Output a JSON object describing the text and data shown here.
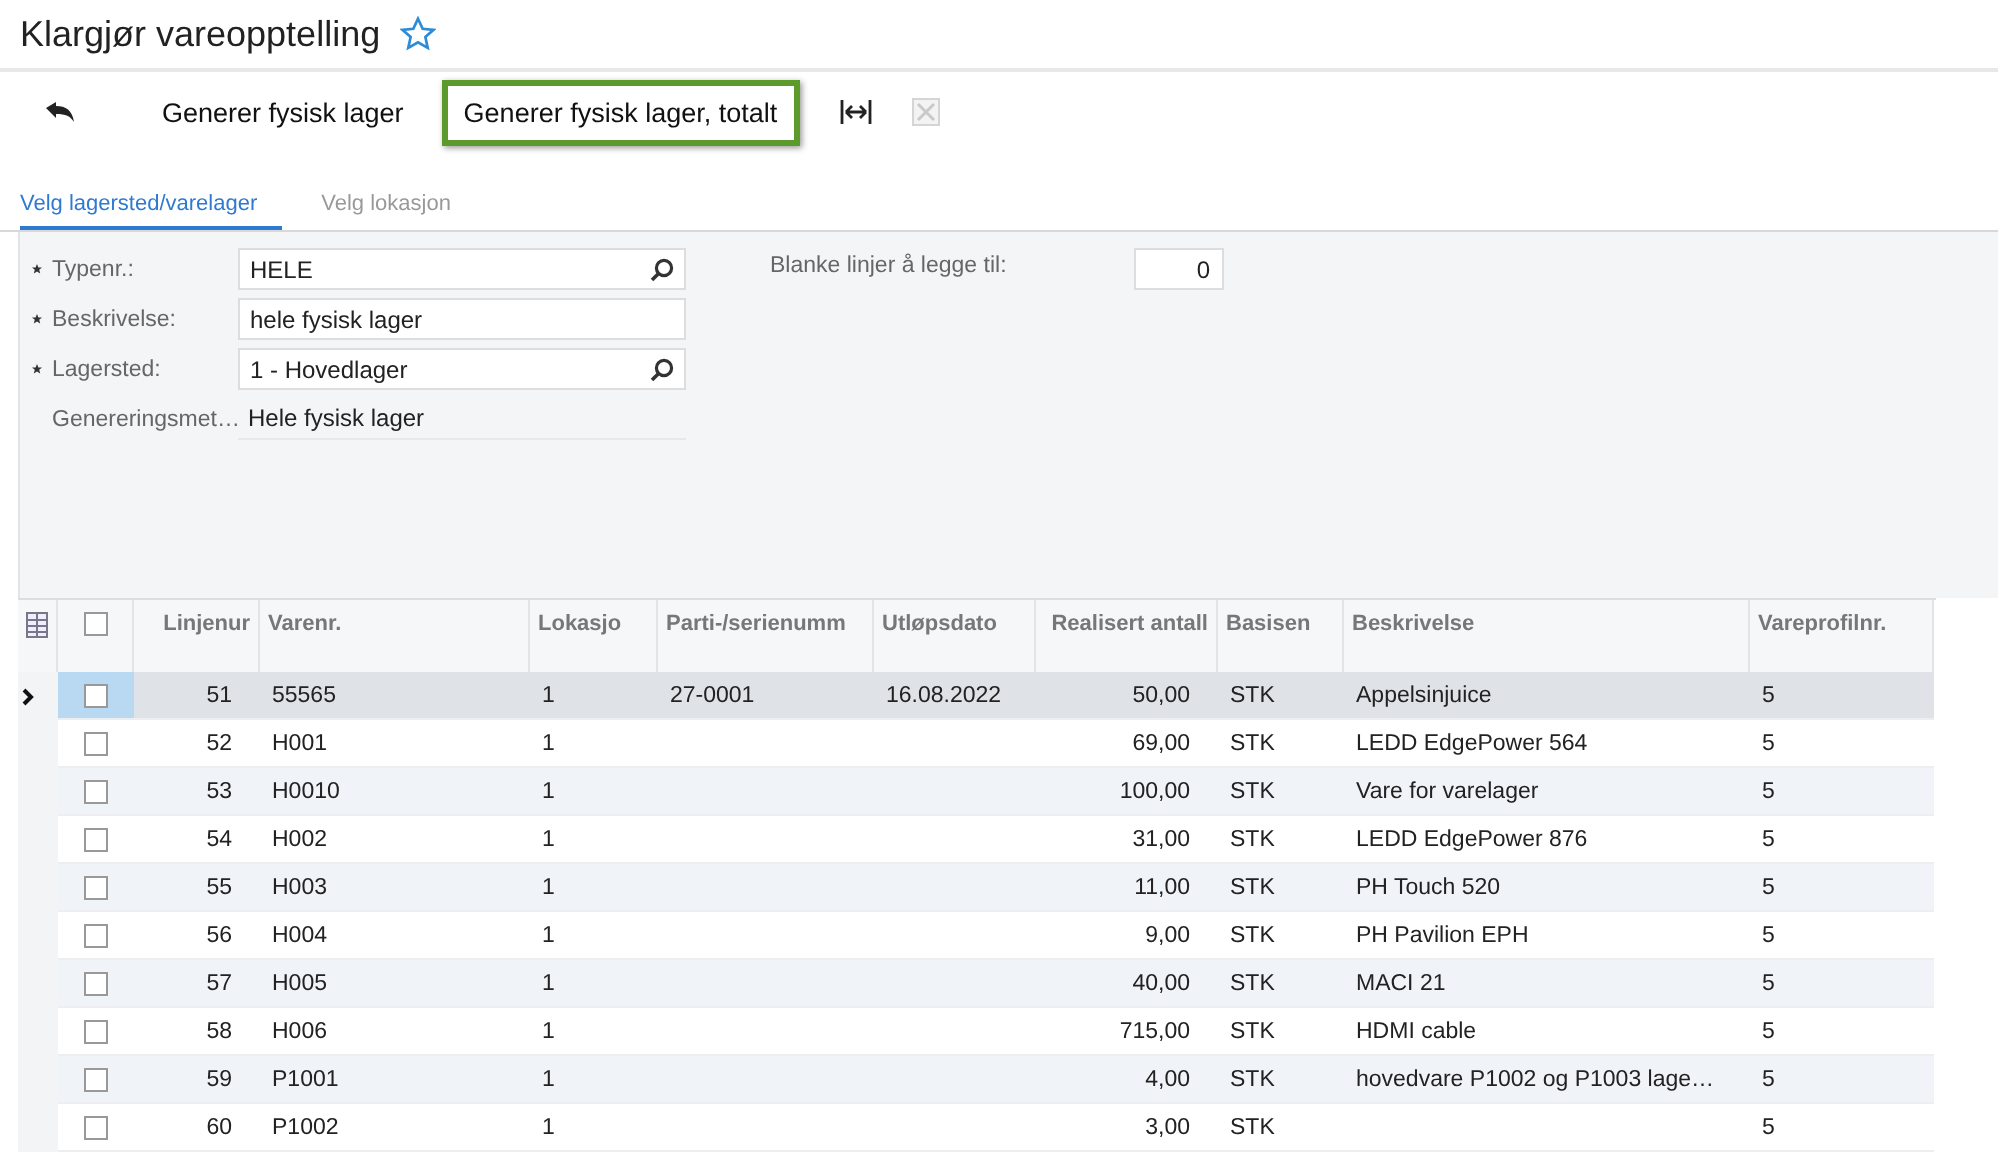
{
  "page": {
    "title": "Klargjør vareopptelling",
    "favorite": false
  },
  "toolbar": [
    {
      "kind": "undo"
    },
    {
      "kind": "text",
      "label": "Generer fysisk lager",
      "highlighted": false
    },
    {
      "kind": "text",
      "label": "Generer fysisk lager, totalt",
      "highlighted": true
    },
    {
      "kind": "fit"
    },
    {
      "kind": "excel",
      "disabled": true
    }
  ],
  "tabs": [
    {
      "label": "Velg lagersted/varelager",
      "selected": true
    },
    {
      "label": "Velg lokasjon",
      "selected": false
    }
  ],
  "form": {
    "fields": [
      {
        "label": "Typenr.:",
        "required": true,
        "kind": "lookup",
        "value": "HELE"
      },
      {
        "label": "Beskrivelse:",
        "required": true,
        "kind": "text",
        "value": "hele fysisk lager"
      },
      {
        "label": "Lagersted:",
        "required": true,
        "kind": "lookup",
        "value": "1 - Hovedlager"
      },
      {
        "label": "Genereringsmet…",
        "required": false,
        "kind": "readonly",
        "value": "Hele fysisk lager"
      }
    ],
    "blank_lines": {
      "label": "Blanke linjer å legge til:",
      "value": "0"
    }
  },
  "table": {
    "all_checked": false,
    "columns": [
      "Linjenur",
      "Varenr.",
      "Lokasjo",
      "Parti-/serienumm",
      "Utløpsdato",
      "Realisert antall",
      "Basisen",
      "Beskrivelse",
      "Vareprofilnr."
    ],
    "rows": [
      {
        "selected": true,
        "checked": false,
        "cells": [
          "51",
          "55565",
          "1",
          "27-0001",
          "16.08.2022",
          "50,00",
          "STK",
          "Appelsinjuice",
          "5"
        ]
      },
      {
        "selected": false,
        "checked": false,
        "cells": [
          "52",
          "H001",
          "1",
          "",
          "",
          "69,00",
          "STK",
          "LEDD EdgePower 564",
          "5"
        ]
      },
      {
        "selected": false,
        "checked": false,
        "cells": [
          "53",
          "H0010",
          "1",
          "",
          "",
          "100,00",
          "STK",
          "Vare for varelager",
          "5"
        ]
      },
      {
        "selected": false,
        "checked": false,
        "cells": [
          "54",
          "H002",
          "1",
          "",
          "",
          "31,00",
          "STK",
          "LEDD EdgePower 876",
          "5"
        ]
      },
      {
        "selected": false,
        "checked": false,
        "cells": [
          "55",
          "H003",
          "1",
          "",
          "",
          "11,00",
          "STK",
          "PH Touch 520",
          "5"
        ]
      },
      {
        "selected": false,
        "checked": false,
        "cells": [
          "56",
          "H004",
          "1",
          "",
          "",
          "9,00",
          "STK",
          "PH Pavilion EPH",
          "5"
        ]
      },
      {
        "selected": false,
        "checked": false,
        "cells": [
          "57",
          "H005",
          "1",
          "",
          "",
          "40,00",
          "STK",
          "MACI 21",
          "5"
        ]
      },
      {
        "selected": false,
        "checked": false,
        "cells": [
          "58",
          "H006",
          "1",
          "",
          "",
          "715,00",
          "STK",
          "HDMI cable",
          "5"
        ]
      },
      {
        "selected": false,
        "checked": false,
        "cells": [
          "59",
          "P1001",
          "1",
          "",
          "",
          "4,00",
          "STK",
          "hovedvare P1002 og P1003 lage…",
          "5"
        ]
      },
      {
        "selected": false,
        "checked": false,
        "cells": [
          "60",
          "P1002",
          "1",
          "",
          "",
          "3,00",
          "STK",
          "",
          "5"
        ]
      }
    ]
  }
}
